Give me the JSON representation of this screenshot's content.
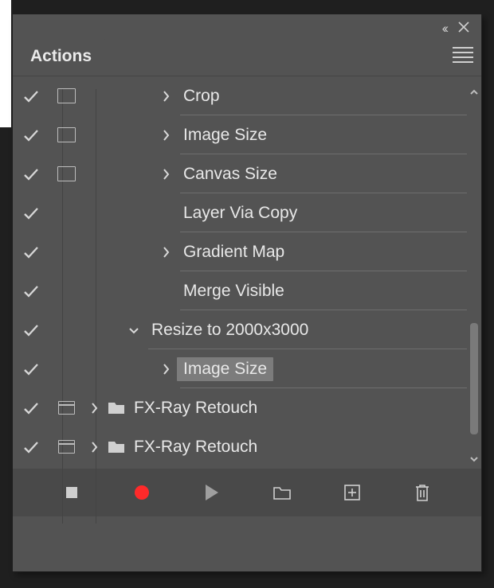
{
  "panel": {
    "title": "Actions"
  },
  "rows": [
    {
      "label": "Crop",
      "checked": true,
      "dialog": "box",
      "expander": "right",
      "indent": 90,
      "folder": false,
      "showIndentExp": false,
      "showRule": true,
      "selected": false
    },
    {
      "label": "Image Size",
      "checked": true,
      "dialog": "box",
      "expander": "right",
      "indent": 90,
      "folder": false,
      "showIndentExp": false,
      "showRule": true,
      "selected": false
    },
    {
      "label": "Canvas Size",
      "checked": true,
      "dialog": "box",
      "expander": "right",
      "indent": 90,
      "folder": false,
      "showIndentExp": false,
      "showRule": true,
      "selected": false
    },
    {
      "label": "Layer Via Copy",
      "checked": true,
      "dialog": "none",
      "expander": "none",
      "indent": 118,
      "folder": false,
      "showIndentExp": false,
      "showRule": true,
      "selected": false
    },
    {
      "label": "Gradient Map",
      "checked": true,
      "dialog": "none",
      "expander": "right",
      "indent": 90,
      "folder": false,
      "showIndentExp": false,
      "showRule": true,
      "selected": false
    },
    {
      "label": "Merge Visible",
      "checked": true,
      "dialog": "none",
      "expander": "none",
      "indent": 118,
      "folder": false,
      "showIndentExp": false,
      "showRule": true,
      "selected": false
    },
    {
      "label": "Resize to 2000x3000",
      "checked": true,
      "dialog": "none",
      "expander": "down",
      "indent": 50,
      "folder": false,
      "showIndentExp": false,
      "showRule": true,
      "selected": false
    },
    {
      "label": "Image Size",
      "checked": true,
      "dialog": "none",
      "expander": "right",
      "indent": 90,
      "folder": false,
      "showIndentExp": false,
      "showRule": true,
      "selected": true
    },
    {
      "label": "FX-Ray Retouch",
      "checked": true,
      "dialog": "bar",
      "expander": "right",
      "indent": 0,
      "folder": true,
      "showIndentExp": true,
      "showRule": false,
      "selected": false
    },
    {
      "label": "FX-Ray Retouch",
      "checked": true,
      "dialog": "bar",
      "expander": "right",
      "indent": 0,
      "folder": true,
      "showIndentExp": true,
      "showRule": false,
      "selected": false
    }
  ],
  "footer": {
    "buttons": [
      "stop",
      "record",
      "play",
      "new-folder",
      "new-action",
      "delete"
    ]
  }
}
